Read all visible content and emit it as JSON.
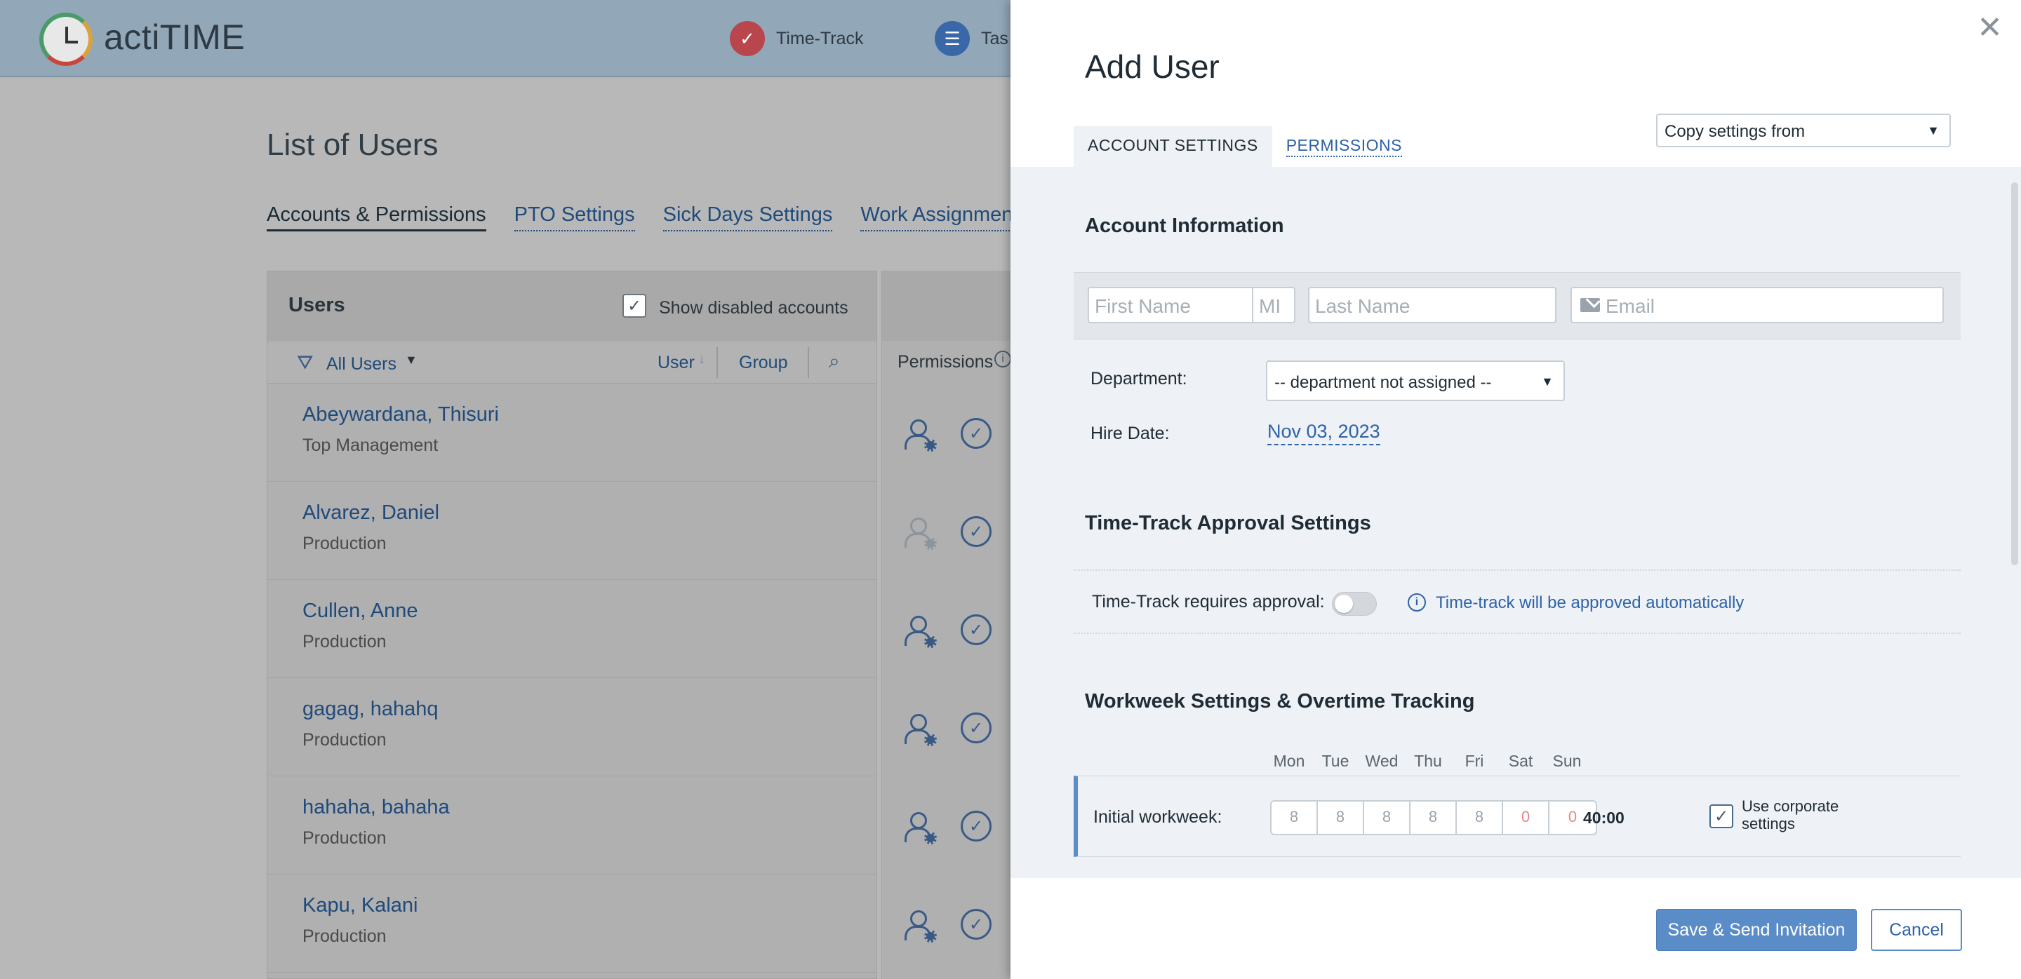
{
  "app": {
    "brand": "actiTIME",
    "nav": [
      {
        "label": "Time-Track"
      },
      {
        "label": "Tas"
      }
    ]
  },
  "page": {
    "title": "List of Users",
    "subtabs": [
      "Accounts & Permissions",
      "PTO Settings",
      "Sick Days Settings",
      "Work Assignments"
    ],
    "users_panel": {
      "title": "Users",
      "show_disabled_label": "Show disabled accounts",
      "show_disabled_checked": true,
      "filter_label": "All Users",
      "col_user": "User",
      "col_group": "Group"
    },
    "permissions_label": "Permissions",
    "users": [
      {
        "name": "Abeywardana, Thisuri",
        "dept": "Top Management",
        "user_icon_active": true
      },
      {
        "name": "Alvarez, Daniel",
        "dept": "Production",
        "user_icon_active": false
      },
      {
        "name": "Cullen, Anne",
        "dept": "Production",
        "user_icon_active": true
      },
      {
        "name": "gagag, hahahq",
        "dept": "Production",
        "user_icon_active": true
      },
      {
        "name": "hahaha, bahaha",
        "dept": "Production",
        "user_icon_active": true
      },
      {
        "name": "Kapu, Kalani",
        "dept": "Production",
        "user_icon_active": true
      }
    ]
  },
  "modal": {
    "title": "Add User",
    "copy_settings": "Copy settings from",
    "tabs": {
      "account": "ACCOUNT SETTINGS",
      "permissions": "PERMISSIONS"
    },
    "account_info": {
      "title": "Account Information",
      "first_name_ph": "First Name",
      "mi_ph": "MI",
      "last_name_ph": "Last Name",
      "email_ph": "Email",
      "department_label": "Department:",
      "department_value": "-- department not assigned --",
      "hire_date_label": "Hire Date:",
      "hire_date_value": "Nov 03, 2023"
    },
    "approval": {
      "title": "Time-Track Approval Settings",
      "label": "Time-Track requires approval:",
      "enabled": false,
      "info": "Time-track will be approved automatically"
    },
    "workweek": {
      "title": "Workweek Settings & Overtime Tracking",
      "days": [
        "Mon",
        "Tue",
        "Wed",
        "Thu",
        "Fri",
        "Sat",
        "Sun"
      ],
      "label": "Initial workweek:",
      "hours": [
        "8",
        "8",
        "8",
        "8",
        "8",
        "0",
        "0"
      ],
      "total": "40:00",
      "use_corporate_label": "Use corporate settings",
      "use_corporate_checked": true
    },
    "buttons": {
      "save": "Save & Send Invitation",
      "cancel": "Cancel"
    }
  },
  "colors": {
    "accent": "#5a8cc8",
    "link": "#2d63a8",
    "weekend": "#e08a86"
  }
}
